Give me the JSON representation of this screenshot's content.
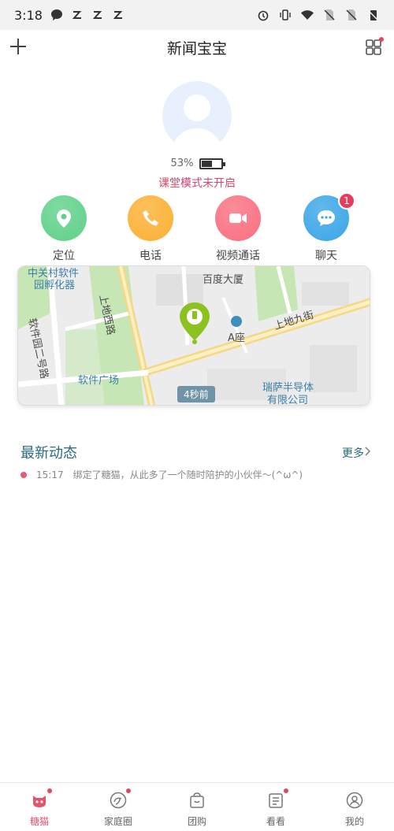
{
  "status_bar": {
    "time": "3:18"
  },
  "header": {
    "title": "新闻宝宝"
  },
  "device": {
    "battery_percent_text": "53%",
    "battery_level": 0.53,
    "classroom_mode": "课堂模式未开启"
  },
  "actions": [
    {
      "label": "定位",
      "color": "#5fd18a"
    },
    {
      "label": "电话",
      "color": "#fbb033"
    },
    {
      "label": "视频通话",
      "color": "#f96f80"
    },
    {
      "label": "聊天",
      "color": "#3aa6e7",
      "badge": "1"
    }
  ],
  "map": {
    "labels": [
      "中关村软件",
      "园孵化器",
      "上地西路",
      "百度大厦",
      "软件园二号路",
      "A座",
      "上地九街",
      "软件广场",
      "瑞萨半导体",
      "有限公司"
    ],
    "updated": "4秒前"
  },
  "latest": {
    "title": "最新动态",
    "more": "更多",
    "items": [
      {
        "time": "15:17",
        "text": "绑定了糖猫，从此多了一个随时陪护的小伙伴～(^ω^)"
      }
    ]
  },
  "tabbar": {
    "items": [
      {
        "label": "糖猫",
        "active": true
      },
      {
        "label": "家庭圈"
      },
      {
        "label": "团购"
      },
      {
        "label": "看看"
      },
      {
        "label": "我的"
      }
    ]
  },
  "colors": {
    "accent": "#e35471",
    "teal": "#2a6a7c",
    "map_green": "#c6e7b5",
    "pin": "#8bc220"
  }
}
